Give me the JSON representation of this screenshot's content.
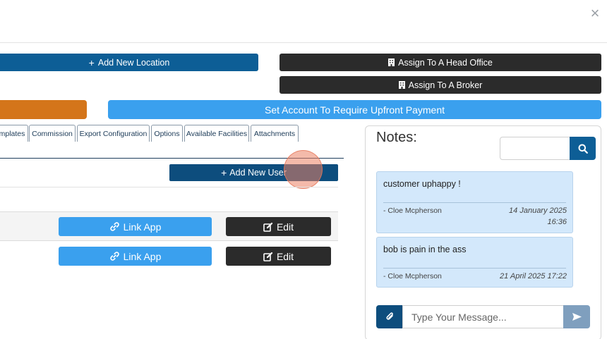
{
  "dialog": {
    "close_label": "×"
  },
  "actions": {
    "add_location": "Add New Location",
    "assign_head_office": "Assign To A Head Office",
    "assign_broker": "Assign To A Broker",
    "upfront_payment": "Set Account To Require Upfront Payment"
  },
  "tabs": [
    {
      "label": "mplates"
    },
    {
      "label": "Commission"
    },
    {
      "label": "Export Configuration"
    },
    {
      "label": "Options"
    },
    {
      "label": "Available Facilities"
    },
    {
      "label": "Attachments"
    }
  ],
  "users": {
    "add_label": "Add New User",
    "rows": [
      {
        "link_label": "Link App",
        "edit_label": "Edit"
      },
      {
        "link_label": "Link App",
        "edit_label": "Edit"
      }
    ]
  },
  "notes": {
    "title": "Notes:",
    "search_value": "",
    "items": [
      {
        "text": "customer uphappy !",
        "author": "- Cloe Mcpherson",
        "date_line1": "14 January 2025",
        "date_line2": "16:36"
      },
      {
        "text": "bob is pain in the ass",
        "author": "- Cloe Mcpherson",
        "date_line1": "21 April 2025 17:22",
        "date_line2": ""
      }
    ],
    "message_placeholder": "Type Your Message..."
  },
  "colors": {
    "primary_dark_blue": "#0d5e96",
    "navy": "#0d4d7d",
    "dark": "#2b2b2b",
    "orange": "#d4751a",
    "light_blue": "#3aa0ee",
    "note_bg": "#d3e8fb"
  },
  "icons": [
    "close-icon",
    "plus-icon",
    "building-icon",
    "link-icon",
    "edit-icon",
    "search-icon",
    "paperclip-icon",
    "send-icon"
  ]
}
